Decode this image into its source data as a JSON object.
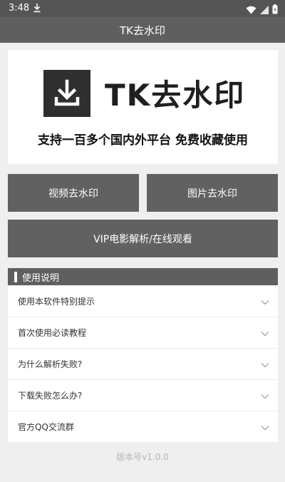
{
  "status_bar": {
    "time": "3:48"
  },
  "app_bar": {
    "title": "TK去水印"
  },
  "hero": {
    "logo_text": "TK去水印",
    "slogan": "支持一百多个国内外平台 免费收藏使用"
  },
  "buttons": {
    "video_label": "视频去水印",
    "image_label": "图片去水印",
    "vip_label": "VIP电影解析/在线观看"
  },
  "section": {
    "title": "使用说明"
  },
  "faq_items": [
    {
      "label": "使用本软件特别提示"
    },
    {
      "label": "首次使用必读教程"
    },
    {
      "label": "为什么解析失败?"
    },
    {
      "label": "下载失败怎么办?"
    },
    {
      "label": "官方QQ交流群"
    }
  ],
  "footer": {
    "version": "版本号v1.0.0"
  },
  "colors": {
    "status_bar": "#555555",
    "app_bar": "#5f5f5f",
    "button": "#616161",
    "background": "#efefef"
  },
  "icons": [
    "download-icon",
    "wifi-icon",
    "signal-icon",
    "battery-icon",
    "chevron-down-icon"
  ]
}
